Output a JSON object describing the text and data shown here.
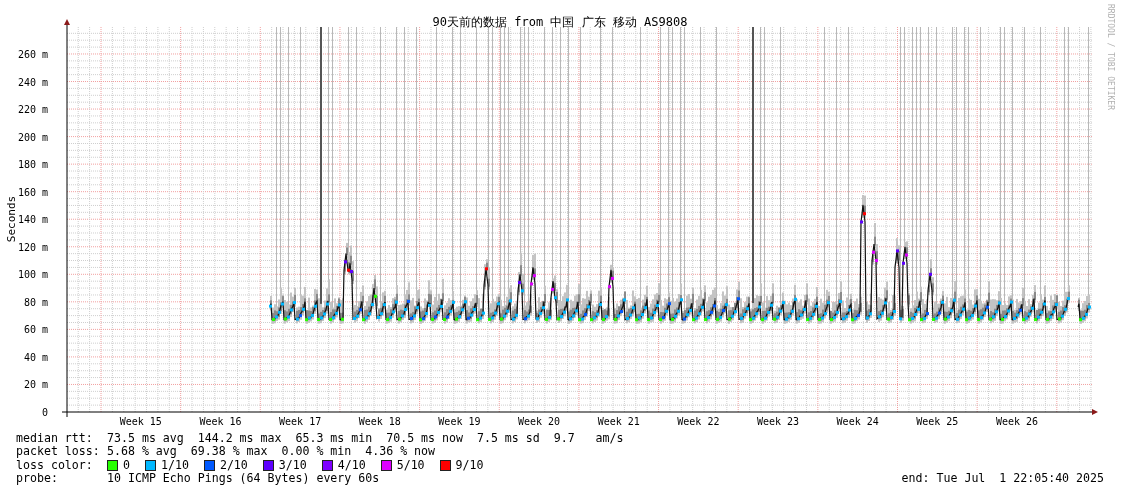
{
  "title": "90天前的数据 from 中国 广东 移动 AS9808",
  "side_credit": "RRDTOOL / TOBI OETIKER",
  "chart": {
    "ylabel": "Seconds",
    "yticks": [
      "260 m",
      "240 m",
      "220 m",
      "200 m",
      "180 m",
      "160 m",
      "140 m",
      "120 m",
      "100 m",
      "80 m",
      "60 m",
      "40 m",
      "20 m",
      "0"
    ],
    "week_labels": [
      "Week 15",
      "Week 16",
      "Week 17",
      "Week 18",
      "Week 19",
      "Week 20",
      "Week 21",
      "Week 22",
      "Week 23",
      "Week 24",
      "Week 25",
      "Week 26"
    ]
  },
  "stats": [
    {
      "label": "median rtt:",
      "text": "73.5 ms avg  144.2 ms max  65.3 ms min  70.5 ms now  7.5 ms sd  9.7   am/s"
    },
    {
      "label": "packet loss:",
      "text": "5.68 % avg  69.38 % max  0.00 % min  4.36 % now"
    }
  ],
  "loss_color": {
    "label": "loss color:",
    "items": [
      {
        "label": "0",
        "color": "#26ff00"
      },
      {
        "label": "1/10",
        "color": "#00b8ff"
      },
      {
        "label": "2/10",
        "color": "#0059ff"
      },
      {
        "label": "3/10",
        "color": "#5e00ff"
      },
      {
        "label": "4/10",
        "color": "#7e00ff"
      },
      {
        "label": "5/10",
        "color": "#dd00ff"
      },
      {
        "label": "9/10",
        "color": "#ff0000"
      }
    ]
  },
  "probe": {
    "label": "probe:",
    "text": "10 ICMP Echo Pings (64 Bytes) every 60s"
  },
  "end": "end: Tue Jul  1 22:05:40 2025"
}
